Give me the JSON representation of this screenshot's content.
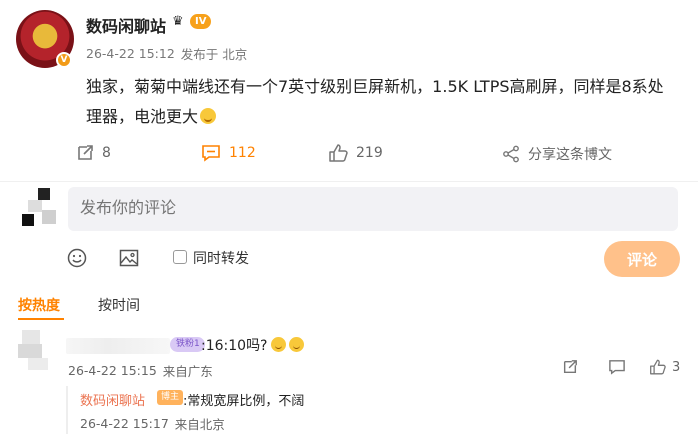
{
  "post": {
    "author": "数码闲聊站",
    "author_badge": "V",
    "level": "IV",
    "time": "26-4-22 15:12",
    "source": "发布于 北京",
    "text": "独家，菊菊中端线还有一个7英寸级别巨屏新机，1.5K LTPS高刷屏，同样是8系处理器，电池更大"
  },
  "actions": {
    "repost_count": "8",
    "comment_count": "112",
    "like_count": "219",
    "share_label": "分享这条博文"
  },
  "composer": {
    "placeholder": "发布你的评论",
    "repost_label": "同时转发",
    "submit_label": "评论"
  },
  "sort": {
    "hot": "按热度",
    "time": "按时间"
  },
  "comments": [
    {
      "badge": "铁粉1",
      "text": ":16:10吗?",
      "time": "26-4-22 15:15",
      "source": "来自广东",
      "like_count": "3",
      "replies": [
        {
          "author": "数码闲聊站",
          "badge": "博主",
          "text": ":常规宽屏比例，不阔",
          "time": "26-4-22 15:17",
          "source": "来自北京"
        }
      ]
    }
  ],
  "colors": {
    "accent": "#ff8200",
    "submit": "#ffc18a",
    "reply_name": "#eb7350"
  }
}
